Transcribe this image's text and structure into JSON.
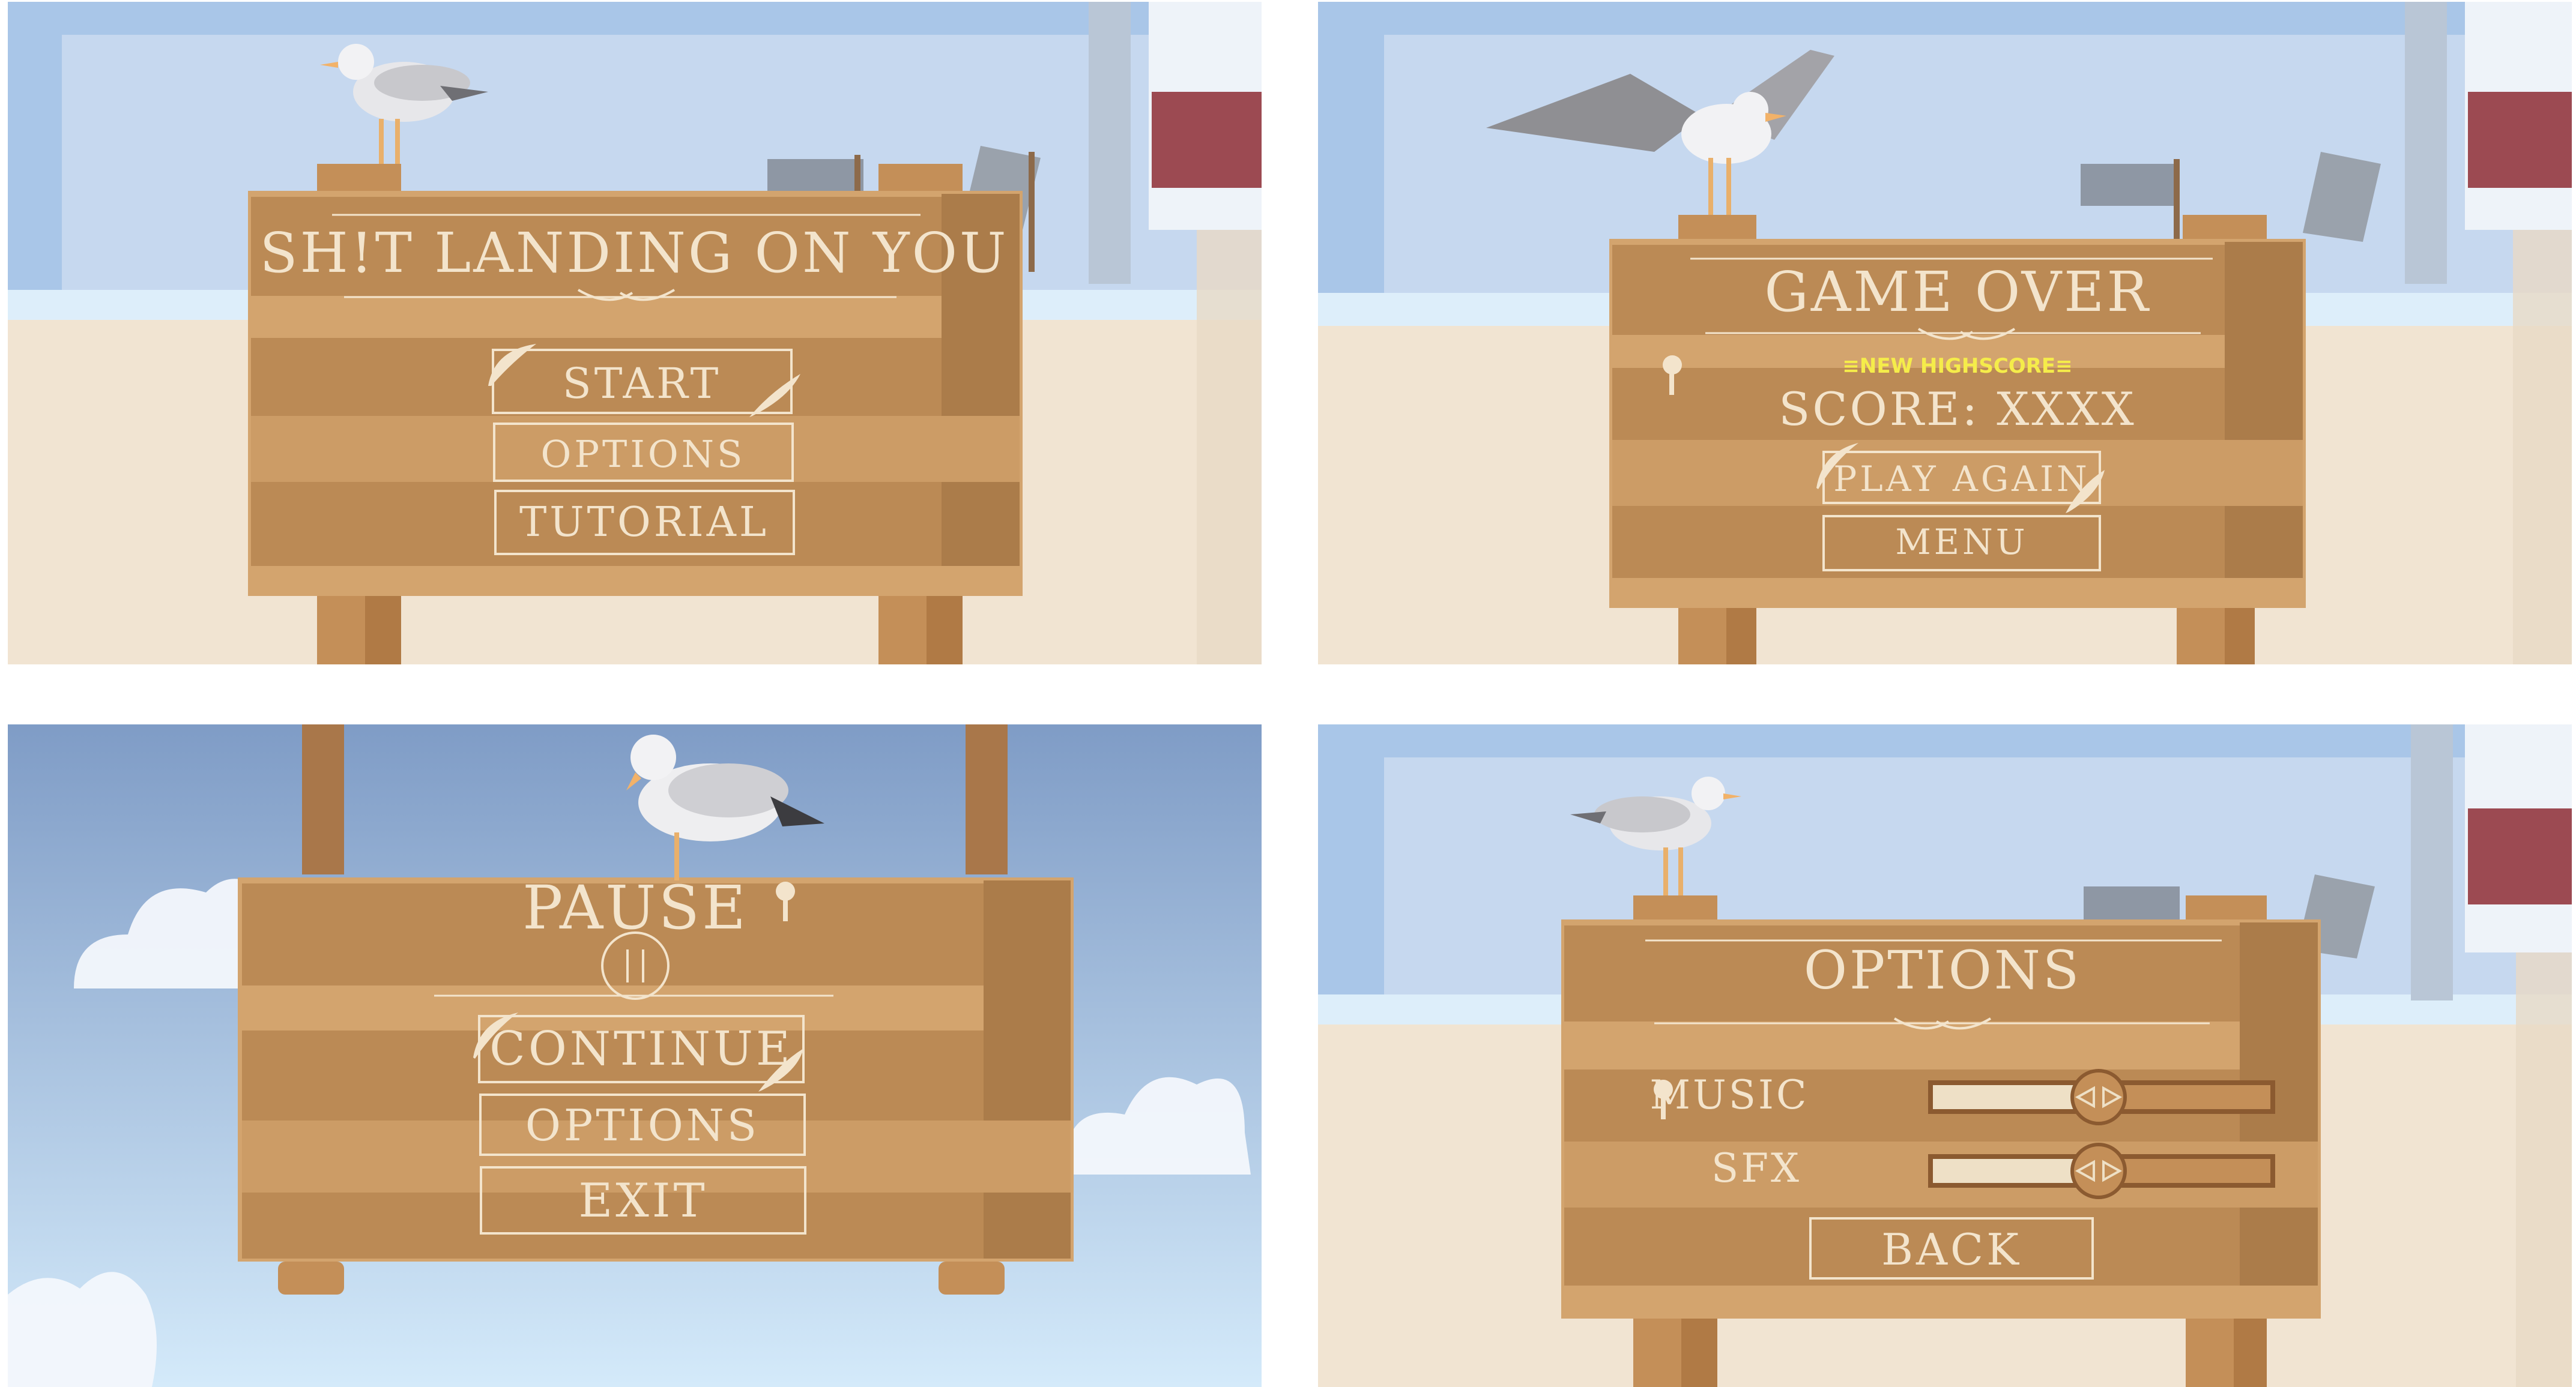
{
  "screens": {
    "main_menu": {
      "title": "SH!T LANDING ON YOU",
      "buttons": [
        "START",
        "OPTIONS",
        "TUTORIAL"
      ]
    },
    "game_over": {
      "title": "GAME OVER",
      "highscore_badge": "≡NEW HIGHSCORE≡",
      "score": "SCORE: XXXX",
      "buttons": [
        "PLAY AGAIN",
        "MENU"
      ]
    },
    "pause": {
      "title": "PAUSE",
      "buttons": [
        "CONTINUE",
        "OPTIONS",
        "EXIT"
      ]
    },
    "options": {
      "title": "OPTIONS",
      "sliders": [
        {
          "label": "MUSIC",
          "value": 0.5
        },
        {
          "label": "SFX",
          "value": 0.5
        }
      ],
      "back_label": "BACK"
    }
  },
  "colors": {
    "wood": "#c48f58",
    "wood_dark": "#b5844f",
    "wood_light": "#d3a46e",
    "text": "#f3e4cc",
    "highscore": "#f5ec4a",
    "sky_beach": "#c3d6ee",
    "sky_pause": "#7f9cc6",
    "sand": "#f0e3d0"
  }
}
